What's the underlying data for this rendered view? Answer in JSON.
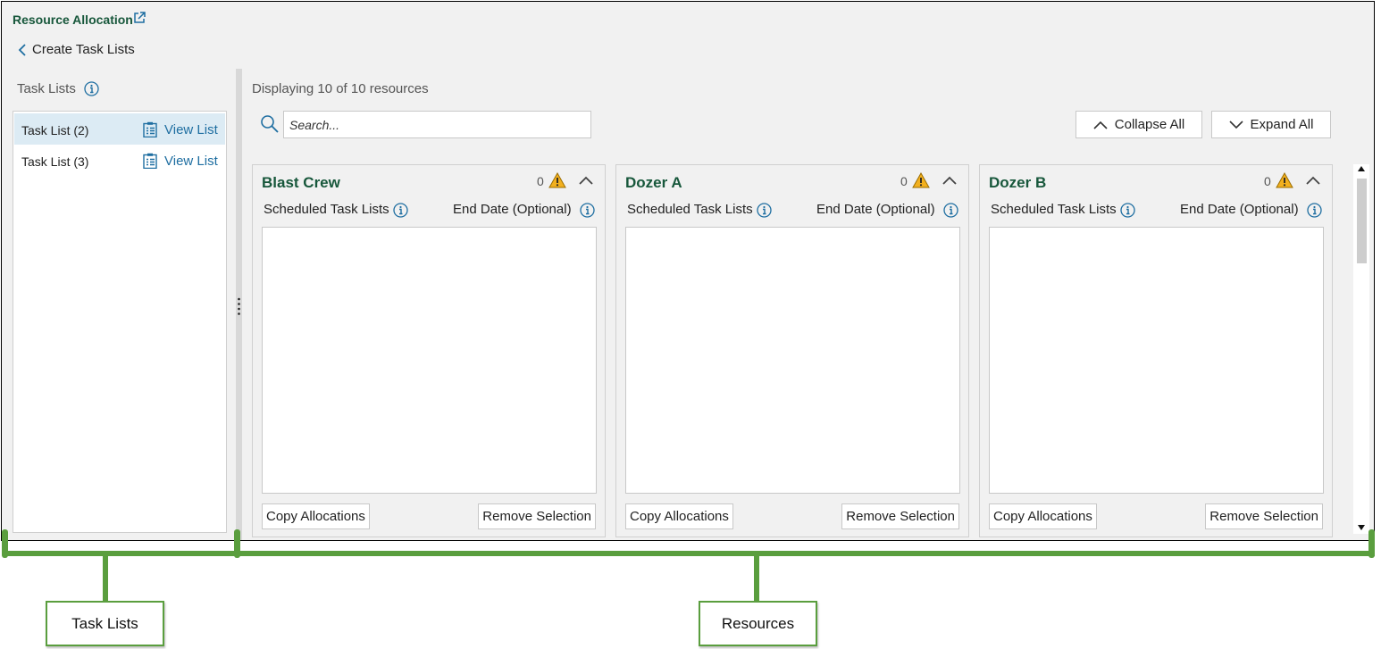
{
  "app": {
    "title": "Resource Allocation",
    "back_label": "Create Task Lists"
  },
  "task_lists": {
    "heading": "Task Lists",
    "items": [
      {
        "name": "Task List (2)",
        "action": "View List",
        "selected": true
      },
      {
        "name": "Task List (3)",
        "action": "View List",
        "selected": false
      }
    ]
  },
  "resources": {
    "count_text": "Displaying 10 of 10 resources",
    "search_placeholder": "Search...",
    "collapse_all": "Collapse All",
    "expand_all": "Expand All",
    "cards": [
      {
        "name": "Blast Crew",
        "warning_count": "0",
        "scheduled_label": "Scheduled Task Lists",
        "end_date_label": "End Date (Optional)",
        "copy_label": "Copy Allocations",
        "remove_label": "Remove Selection"
      },
      {
        "name": "Dozer A",
        "warning_count": "0",
        "scheduled_label": "Scheduled Task Lists",
        "end_date_label": "End Date (Optional)",
        "copy_label": "Copy Allocations",
        "remove_label": "Remove Selection"
      },
      {
        "name": "Dozer B",
        "warning_count": "0",
        "scheduled_label": "Scheduled Task Lists",
        "end_date_label": "End Date (Optional)",
        "copy_label": "Copy Allocations",
        "remove_label": "Remove Selection"
      }
    ]
  },
  "callouts": {
    "task_lists": "Task Lists",
    "resources": "Resources"
  },
  "colors": {
    "accent_green": "#17573b",
    "link_blue": "#1e6ea1",
    "bracket_green": "#5a9e3e",
    "warning_yellow": "#f2b01e"
  }
}
